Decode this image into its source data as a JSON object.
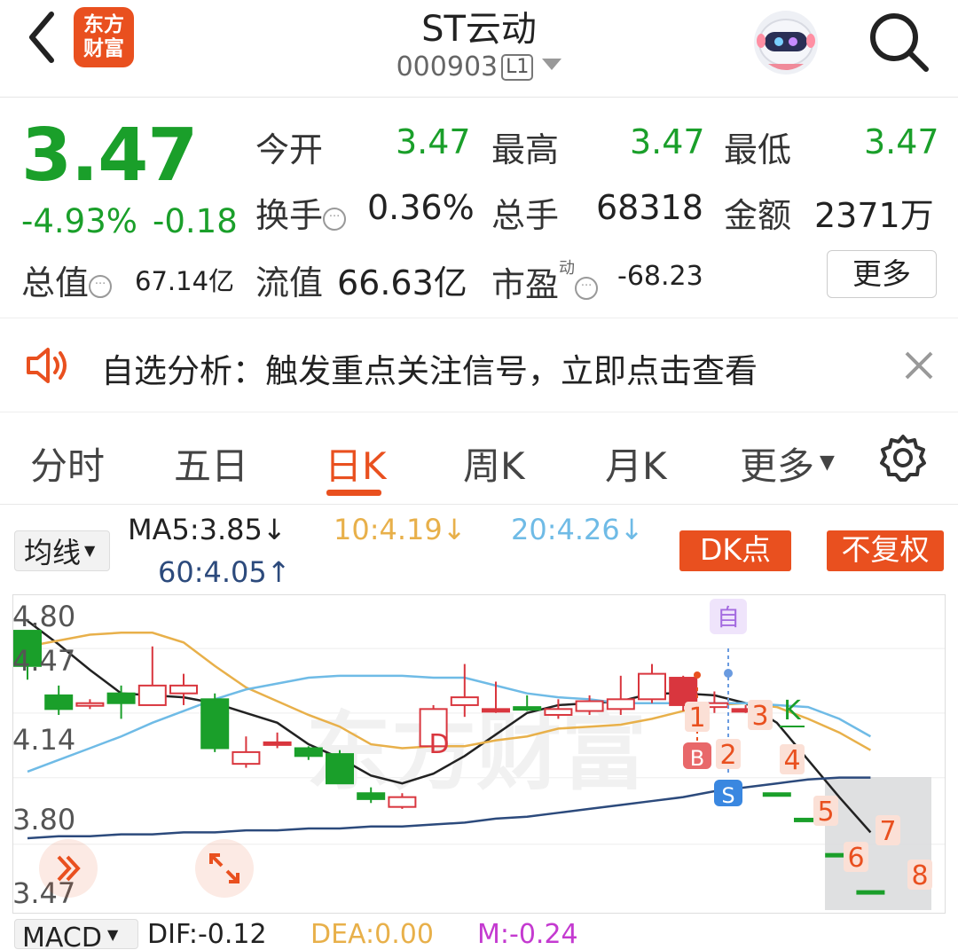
{
  "header": {
    "title": "ST云动",
    "code": "000903",
    "level": "L1",
    "logo_line1": "东方",
    "logo_line2": "财富"
  },
  "quote": {
    "price": "3.47",
    "change_pct": "-4.93%",
    "change_amt": "-0.18",
    "open_label": "今开",
    "open": "3.47",
    "high_label": "最高",
    "high": "3.47",
    "low_label": "最低",
    "low": "3.47",
    "turnover_label": "换手",
    "turnover": "0.36%",
    "volume_label": "总手",
    "volume": "68318",
    "amount_label": "金额",
    "amount": "2371万",
    "mktcap_label": "总值",
    "mktcap": "67.14亿",
    "float_label": "流值",
    "float": "66.63亿",
    "pe_label": "市盈",
    "pe_sup": "动",
    "pe": "-68.23",
    "more_label": "更多"
  },
  "notice": {
    "text": "自选分析：触发重点关注信号，立即点击查看"
  },
  "tabs": [
    "分时",
    "五日",
    "日K",
    "周K",
    "月K",
    "更多"
  ],
  "active_tab": "日K",
  "indicators": {
    "selector": "均线",
    "ma5": "MA5:3.85",
    "ma10": "10:4.19",
    "ma20": "20:4.26",
    "ma60": "60:4.05",
    "dk_label": "DK点",
    "fq_label": "不复权",
    "colors": {
      "ma5": "#222222",
      "ma10": "#e8b04a",
      "ma20": "#6fbbe6",
      "ma60": "#2c4a7c",
      "up": "#d9363e",
      "down": "#1a9f2a",
      "accent": "#e9501f"
    }
  },
  "chart_data": {
    "type": "candlestick",
    "ylim": [
      3.47,
      4.8
    ],
    "y_ticks": [
      "4.80",
      "4.47",
      "4.14",
      "3.80",
      "3.47"
    ],
    "candles": [
      {
        "o": 4.8,
        "c": 4.62,
        "h": 4.8,
        "l": 4.55,
        "dir": "down"
      },
      {
        "o": 4.47,
        "c": 4.4,
        "h": 4.52,
        "l": 4.37,
        "dir": "down"
      },
      {
        "o": 4.42,
        "c": 4.43,
        "h": 4.45,
        "l": 4.4,
        "dir": "up"
      },
      {
        "o": 4.48,
        "c": 4.43,
        "h": 4.52,
        "l": 4.35,
        "dir": "down"
      },
      {
        "o": 4.42,
        "c": 4.52,
        "h": 4.72,
        "l": 4.42,
        "dir": "up"
      },
      {
        "o": 4.48,
        "c": 4.52,
        "h": 4.58,
        "l": 4.42,
        "dir": "up"
      },
      {
        "o": 4.45,
        "c": 4.2,
        "h": 4.48,
        "l": 4.18,
        "dir": "down"
      },
      {
        "o": 4.12,
        "c": 4.18,
        "h": 4.26,
        "l": 4.1,
        "dir": "up"
      },
      {
        "o": 4.23,
        "c": 4.23,
        "h": 4.28,
        "l": 4.2,
        "dir": "up"
      },
      {
        "o": 4.2,
        "c": 4.16,
        "h": 4.21,
        "l": 4.14,
        "dir": "down"
      },
      {
        "o": 4.17,
        "c": 4.02,
        "h": 4.19,
        "l": 4.02,
        "dir": "down"
      },
      {
        "o": 3.97,
        "c": 3.94,
        "h": 4.0,
        "l": 3.92,
        "dir": "down"
      },
      {
        "o": 3.9,
        "c": 3.95,
        "h": 3.97,
        "l": 3.89,
        "dir": "up"
      },
      {
        "o": 4.21,
        "c": 4.4,
        "h": 4.42,
        "l": 4.19,
        "dir": "up"
      },
      {
        "o": 4.42,
        "c": 4.46,
        "h": 4.63,
        "l": 4.36,
        "dir": "up"
      },
      {
        "o": 4.4,
        "c": 4.4,
        "h": 4.54,
        "l": 4.38,
        "dir": "up"
      },
      {
        "o": 4.41,
        "c": 4.4,
        "h": 4.47,
        "l": 4.39,
        "dir": "down"
      },
      {
        "o": 4.37,
        "c": 4.4,
        "h": 4.45,
        "l": 4.35,
        "dir": "up"
      },
      {
        "o": 4.39,
        "c": 4.44,
        "h": 4.47,
        "l": 4.37,
        "dir": "up"
      },
      {
        "o": 4.4,
        "c": 4.45,
        "h": 4.57,
        "l": 4.37,
        "dir": "up"
      },
      {
        "o": 4.45,
        "c": 4.58,
        "h": 4.63,
        "l": 4.43,
        "dir": "up"
      },
      {
        "o": 4.56,
        "c": 4.42,
        "h": 4.57,
        "l": 4.39,
        "dir": "up"
      },
      {
        "o": 4.41,
        "c": 4.43,
        "h": 4.49,
        "l": 4.38,
        "dir": "up"
      },
      {
        "o": 4.4,
        "c": 4.4,
        "h": 4.42,
        "l": 4.38,
        "dir": "up"
      },
      {
        "o": 3.97,
        "c": 3.97,
        "h": 3.97,
        "l": 3.97,
        "dir": "down"
      },
      {
        "o": 3.84,
        "c": 3.84,
        "h": 3.84,
        "l": 3.84,
        "dir": "down"
      },
      {
        "o": 3.66,
        "c": 3.66,
        "h": 3.66,
        "l": 3.66,
        "dir": "down"
      },
      {
        "o": 3.47,
        "c": 3.47,
        "h": 3.47,
        "l": 3.47,
        "dir": "down"
      }
    ],
    "series": [
      {
        "name": "MA5",
        "color": "#222222",
        "values": [
          4.85,
          4.73,
          4.6,
          4.48,
          4.47,
          4.46,
          4.43,
          4.38,
          4.33,
          4.22,
          4.15,
          4.06,
          4.02,
          4.07,
          4.16,
          4.27,
          4.38,
          4.42,
          4.43,
          4.44,
          4.48,
          4.48,
          4.47,
          4.43,
          4.33,
          4.14,
          3.95,
          3.77
        ]
      },
      {
        "name": "10",
        "color": "#e8b04a",
        "values": [
          4.72,
          4.75,
          4.78,
          4.79,
          4.79,
          4.74,
          4.62,
          4.51,
          4.44,
          4.37,
          4.31,
          4.22,
          4.2,
          4.21,
          4.21,
          4.24,
          4.26,
          4.3,
          4.31,
          4.32,
          4.35,
          4.39,
          4.42,
          4.43,
          4.41,
          4.35,
          4.28,
          4.19
        ]
      },
      {
        "name": "20",
        "color": "#6fbbe6",
        "values": [
          4.08,
          4.14,
          4.2,
          4.26,
          4.33,
          4.39,
          4.45,
          4.5,
          4.53,
          4.56,
          4.57,
          4.57,
          4.57,
          4.56,
          4.56,
          4.52,
          4.48,
          4.46,
          4.45,
          4.43,
          4.43,
          4.43,
          4.43,
          4.43,
          4.42,
          4.41,
          4.35,
          4.26
        ]
      },
      {
        "name": "60",
        "color": "#2c4a7c",
        "values": [
          3.74,
          3.75,
          3.75,
          3.76,
          3.76,
          3.77,
          3.77,
          3.78,
          3.78,
          3.79,
          3.79,
          3.8,
          3.8,
          3.81,
          3.82,
          3.84,
          3.85,
          3.87,
          3.89,
          3.91,
          3.93,
          3.95,
          3.98,
          4.0,
          4.02,
          4.04,
          4.05,
          4.05
        ]
      }
    ],
    "markers": [
      "D",
      "1",
      "B",
      "2",
      "S",
      "3",
      "K",
      "4",
      "5",
      "6",
      "7",
      "8",
      "自"
    ],
    "watermark": "东方财富"
  },
  "bottom": {
    "macd": "MACD",
    "dif": "DIF:-0.12",
    "dea": "DEA:0.00",
    "m": "M:-0.24"
  }
}
